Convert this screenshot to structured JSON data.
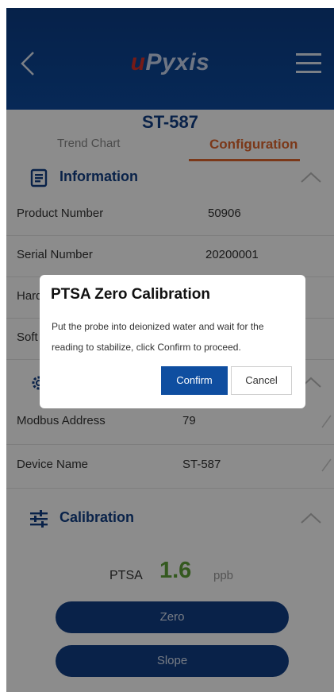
{
  "header": {
    "logo_u": "u",
    "logo_rest": "Pyxis"
  },
  "device_title": "ST-587",
  "tabs": [
    {
      "label": "Trend Chart",
      "active": false
    },
    {
      "label": "Configuration",
      "active": true
    }
  ],
  "information": {
    "title": "Information",
    "rows": [
      {
        "label": "Product Number",
        "value": "50906"
      },
      {
        "label": "Serial Number",
        "value": "20200001"
      },
      {
        "label": "Hard",
        "value": ""
      },
      {
        "label": "Soft",
        "value": ""
      }
    ]
  },
  "settings": {
    "rows": [
      {
        "label": "Modbus Address",
        "value": "79"
      },
      {
        "label": "Device Name",
        "value": "ST-587"
      }
    ]
  },
  "calibration": {
    "title": "Calibration",
    "reading_label": "PTSA",
    "reading_value": "1.6",
    "reading_unit": "ppb",
    "zero_label": "Zero",
    "slope_label": "Slope"
  },
  "dialog": {
    "title": "PTSA Zero Calibration",
    "message": "Put the probe into deionized water and wait for the reading to stabilize, click Confirm to proceed.",
    "confirm_label": "Confirm",
    "cancel_label": "Cancel"
  },
  "colors": {
    "brand_blue": "#123f86",
    "accent_orange": "#e0662e",
    "reading_green": "#5fa33a"
  }
}
